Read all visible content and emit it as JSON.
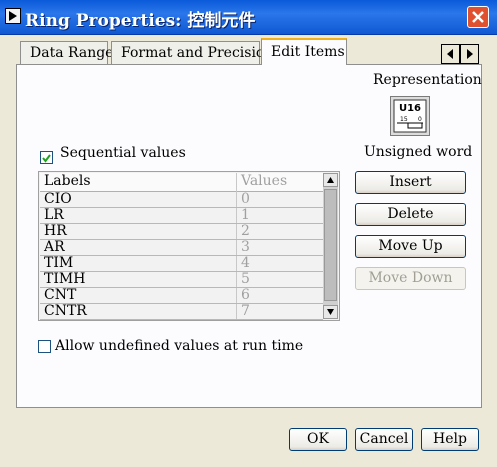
{
  "window": {
    "title": "Ring Properties: 控制元件"
  },
  "tabs": [
    {
      "label": "Data Range"
    },
    {
      "label": "Format and Precision"
    },
    {
      "label": "Edit Items"
    }
  ],
  "representation": {
    "label": "Representation",
    "icon_text": "U16",
    "value": "Unsigned word"
  },
  "sequential": {
    "label": "Sequential values",
    "checked": true
  },
  "table": {
    "headers": {
      "labels": "Labels",
      "values": "Values"
    },
    "rows": [
      {
        "label": "CIO",
        "value": "0"
      },
      {
        "label": "LR",
        "value": "1"
      },
      {
        "label": "HR",
        "value": "2"
      },
      {
        "label": "AR",
        "value": "3"
      },
      {
        "label": "TIM",
        "value": "4"
      },
      {
        "label": "TIMH",
        "value": "5"
      },
      {
        "label": "CNT",
        "value": "6"
      },
      {
        "label": "CNTR",
        "value": "7"
      }
    ]
  },
  "side_buttons": {
    "insert": "Insert",
    "delete": "Delete",
    "move_up": "Move Up",
    "move_down": "Move Down"
  },
  "allow_undefined": {
    "label": "Allow undefined values at run time",
    "checked": false
  },
  "footer": {
    "ok": "OK",
    "cancel": "Cancel",
    "help": "Help"
  }
}
